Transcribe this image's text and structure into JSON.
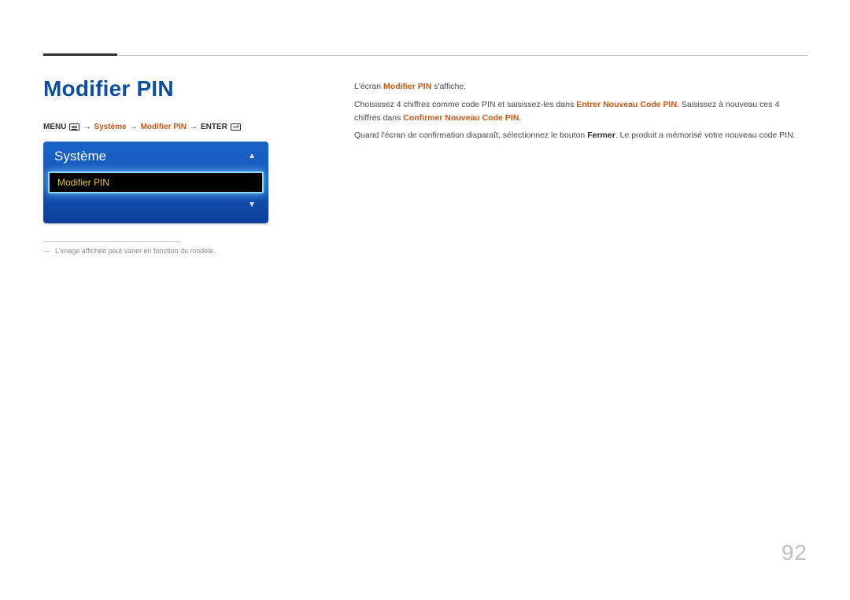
{
  "page": {
    "number": "92",
    "title": "Modifier PIN"
  },
  "breadcrumb": {
    "menu": "MENU",
    "systeme": "Système",
    "modifier_pin": "Modifier PIN",
    "enter": "ENTER",
    "arrow": "→"
  },
  "osd": {
    "header": "Système",
    "selected": "Modifier PIN"
  },
  "footnote": {
    "marker": "―",
    "text": "L'image affichée peut varier en fonction du modèle."
  },
  "body": {
    "p1_a": "L'écran ",
    "p1_b": "Modifier PIN",
    "p1_c": " s'affiche.",
    "p2_a": "Choisissez 4 chiffres comme code PIN et saisissez-les dans ",
    "p2_b": "Entrer Nouveau Code PIN",
    "p2_c": ". Saisissez à nouveau ces 4 chiffres dans ",
    "p2_d": "Confirmer Nouveau Code PIN",
    "p2_e": ".",
    "p3_a": "Quand l'écran de confirmation disparaît, sélectionnez le bouton ",
    "p3_b": "Fermer",
    "p3_c": ". Le produit a mémorisé votre nouveau code PIN."
  }
}
